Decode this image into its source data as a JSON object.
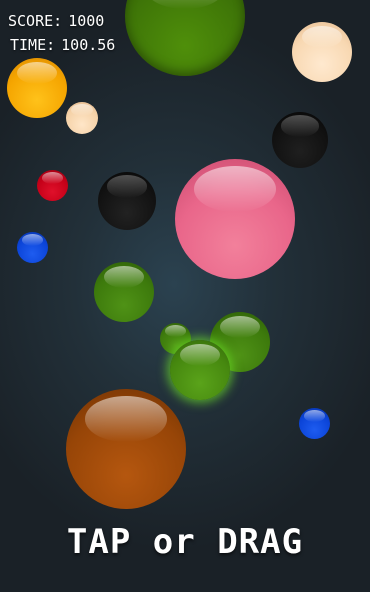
{
  "hud": {
    "score_label": "SCORE:",
    "score_value": "1000",
    "time_label": "TIME:",
    "time_value": "100.56"
  },
  "prompt": "TAP or DRAG",
  "balls": [
    {
      "id": "green-top",
      "color": "#3f7608"
    },
    {
      "id": "cream-top-right",
      "color": "#f8d8b2"
    },
    {
      "id": "yellow",
      "color": "#f5a500"
    },
    {
      "id": "cream-small",
      "color": "#f5d2a8"
    },
    {
      "id": "black-right",
      "color": "#111111"
    },
    {
      "id": "red",
      "color": "#c40018"
    },
    {
      "id": "black-mid",
      "color": "#121212"
    },
    {
      "id": "pink",
      "color": "#e9668a"
    },
    {
      "id": "blue-left",
      "color": "#0b44d8"
    },
    {
      "id": "green-mid",
      "color": "#3d7a0c"
    },
    {
      "id": "green-tiny",
      "color": "#3d7a0c"
    },
    {
      "id": "green-right",
      "color": "#3d7a0c"
    },
    {
      "id": "green-glow",
      "color": "#46880f"
    },
    {
      "id": "blue-right",
      "color": "#0b44d8"
    },
    {
      "id": "brown",
      "color": "#974507"
    }
  ],
  "colors": {
    "background": "#223039",
    "text": "#ffffff",
    "selected_glow": "#6ee628"
  }
}
